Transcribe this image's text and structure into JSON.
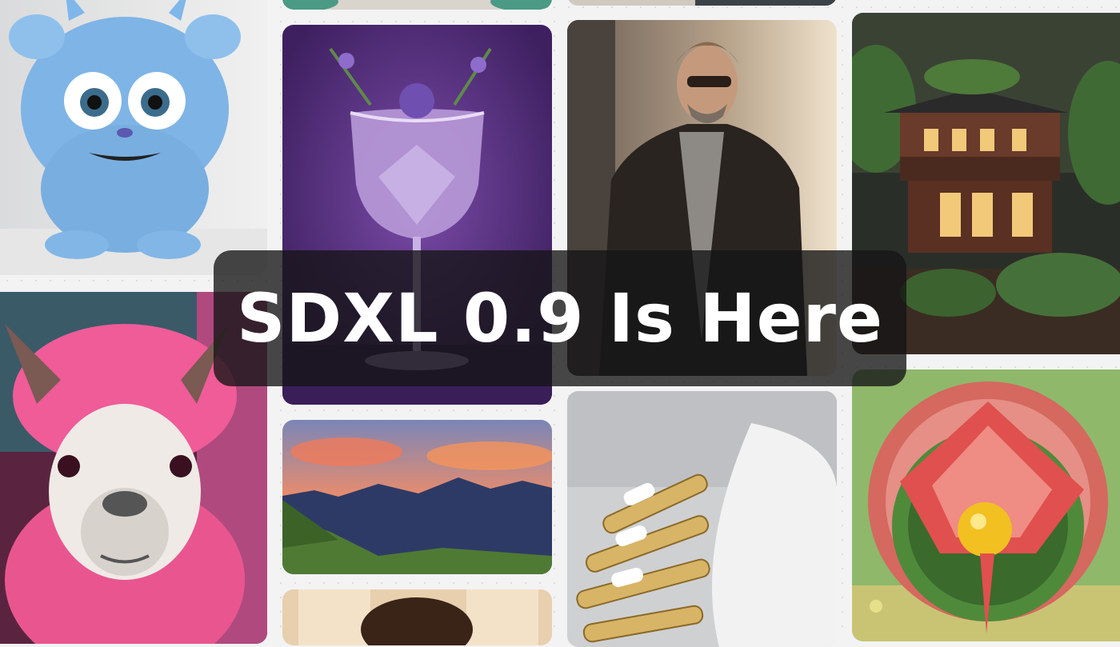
{
  "banner": {
    "title": "SDXL 0.9 Is Here"
  },
  "gallery": {
    "tiles": [
      {
        "subject": "blue-monster"
      },
      {
        "subject": "pink-llama"
      },
      {
        "subject": "lavender-cocktail"
      },
      {
        "subject": "mountain-sunset"
      },
      {
        "subject": "man-leather-jacket"
      },
      {
        "subject": "robot-hand"
      },
      {
        "subject": "miniature-house"
      },
      {
        "subject": "watermelon-painting"
      }
    ]
  },
  "colors": {
    "page_background": "#f3f3f4",
    "banner_overlay": "#141416",
    "banner_text": "#ffffff"
  }
}
